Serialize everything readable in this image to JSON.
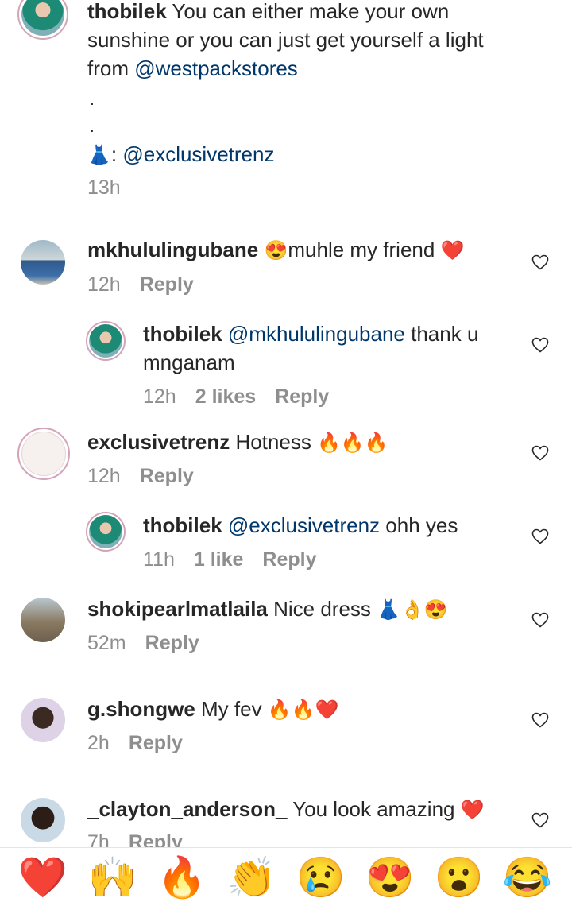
{
  "caption": {
    "username": "thobilek",
    "text_line1": " You can either make your own",
    "text_line2": "sunshine or you can just get yourself a light",
    "text_line3_prefix": "from ",
    "mention1": "@westpackstores",
    "dot1": ".",
    "dot2": ".",
    "dress_emoji": "👗",
    "colon": ": ",
    "mention2": "@exclusivetrenz",
    "time": "13h"
  },
  "comments": [
    {
      "username": "mkhululingubane",
      "emoji_pre": "😍",
      "text": "muhle my friend ",
      "emoji_post": "❤️",
      "time": "12h",
      "reply": "Reply"
    },
    {
      "username": "thobilek",
      "mention": "@mkhululingubane",
      "text": " thank u",
      "text2": "mnganam",
      "time": "12h",
      "likes": "2 likes",
      "reply": "Reply"
    },
    {
      "username": "exclusivetrenz",
      "text": " Hotness ",
      "emoji_post": "🔥🔥🔥",
      "time": "12h",
      "reply": "Reply"
    },
    {
      "username": "thobilek",
      "mention": "@exclusivetrenz",
      "text": " ohh yes",
      "time": "11h",
      "likes": "1 like",
      "reply": "Reply"
    },
    {
      "username": "shokipearlmatlaila",
      "text": " Nice dress ",
      "emoji_post": "👗👌😍",
      "time": "52m",
      "reply": "Reply"
    },
    {
      "username": "g.shongwe",
      "text": " My fev ",
      "emoji_post": "🔥🔥❤️",
      "time": "2h",
      "reply": "Reply"
    },
    {
      "username": "_clayton_anderson_",
      "text": " You look amazing ",
      "emoji_post": "❤️",
      "time": "7h",
      "reply": "Reply"
    }
  ],
  "emoji_bar": [
    "❤️",
    "🙌",
    "🔥",
    "👏",
    "😢",
    "😍",
    "😮",
    "😂"
  ],
  "icons": {
    "like": "heart-outline-icon"
  },
  "colors": {
    "mention": "#00376b",
    "meta": "#8e8e8e",
    "text": "#262626"
  }
}
